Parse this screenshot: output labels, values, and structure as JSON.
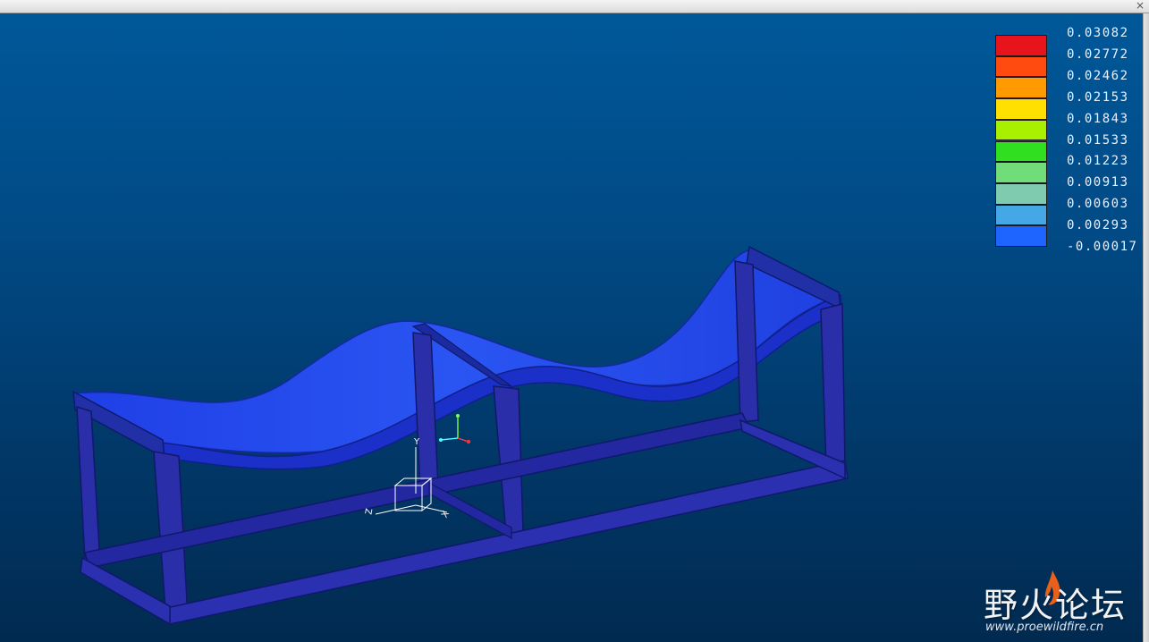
{
  "window": {
    "close_glyph": "×"
  },
  "legend": {
    "labels": [
      "0.03082",
      "0.02772",
      "0.02462",
      "0.02153",
      "0.01843",
      "0.01533",
      "0.01223",
      "0.00913",
      "0.00603",
      "0.00293",
      "-0.00017"
    ],
    "colors": [
      "#e8141c",
      "#ff4a10",
      "#ff9a00",
      "#ffe000",
      "#a8f000",
      "#30e020",
      "#70dd7a",
      "#7ecbb0",
      "#45a8e6",
      "#1e64ff",
      "#1e32c8"
    ]
  },
  "axes": {
    "y_label": "Y",
    "x_label": "X",
    "z_label": "Z"
  },
  "watermark": {
    "chinese": "野火论坛",
    "url": "www.proewildfire.cn"
  }
}
